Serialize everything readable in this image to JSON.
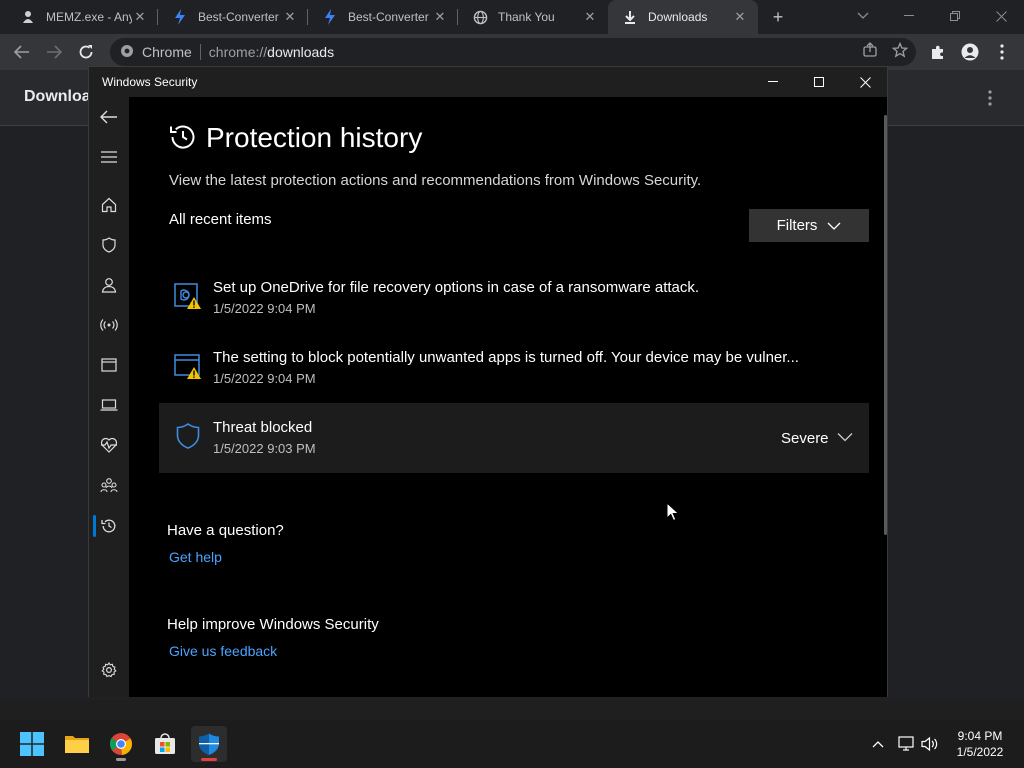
{
  "browser": {
    "tabs": [
      {
        "label": "MEMZ.exe - Any.",
        "icon": "user-silhouette-icon",
        "active": false
      },
      {
        "label": "Best-Converter",
        "icon": "converter-logo-icon",
        "active": false
      },
      {
        "label": "Best-Converter",
        "icon": "converter-logo-icon",
        "active": false
      },
      {
        "label": "Thank You",
        "icon": "globe-icon",
        "active": false
      },
      {
        "label": "Downloads",
        "icon": "download-icon",
        "active": true
      }
    ],
    "address": {
      "site": "Chrome",
      "scheme": "chrome://",
      "path": "downloads"
    },
    "page_title": "Downloa"
  },
  "security_window": {
    "title": "Windows Security",
    "page": {
      "title": "Protection history",
      "subtitle": "View the latest protection actions and recommendations from Windows Security.",
      "section_label": "All recent items",
      "filters_label": "Filters"
    },
    "items": [
      {
        "title": "Set up OneDrive for file recovery options in case of a ransomware attack.",
        "date": "1/5/2022 9:04 PM",
        "icon": "onedrive-warning-icon",
        "severity": ""
      },
      {
        "title": "The setting to block potentially unwanted apps is turned off. Your device may be vulner...",
        "date": "1/5/2022 9:04 PM",
        "icon": "app-browser-warning-icon",
        "severity": ""
      },
      {
        "title": "Threat blocked",
        "date": "1/5/2022 9:03 PM",
        "icon": "shield-icon",
        "severity": "Severe"
      }
    ],
    "help": {
      "question": "Have a question?",
      "link": "Get help"
    },
    "improve": {
      "title": "Help improve Windows Security",
      "link": "Give us feedback"
    },
    "nav": [
      "back-arrow-icon",
      "hamburger-menu-icon",
      "home-icon",
      "shield-icon",
      "account-icon",
      "wireless-icon",
      "app-browser-icon",
      "laptop-icon",
      "heart-pulse-icon",
      "family-icon",
      "history-icon",
      "settings-gear-icon"
    ],
    "accent_color": "#0078d4",
    "link_color": "#4aa3ff"
  },
  "taskbar": {
    "apps": [
      "windows-start-icon",
      "file-explorer-icon",
      "chrome-icon",
      "microsoft-store-icon",
      "windows-security-icon"
    ],
    "clock": {
      "time": "9:04 PM",
      "date": "1/5/2022"
    }
  }
}
